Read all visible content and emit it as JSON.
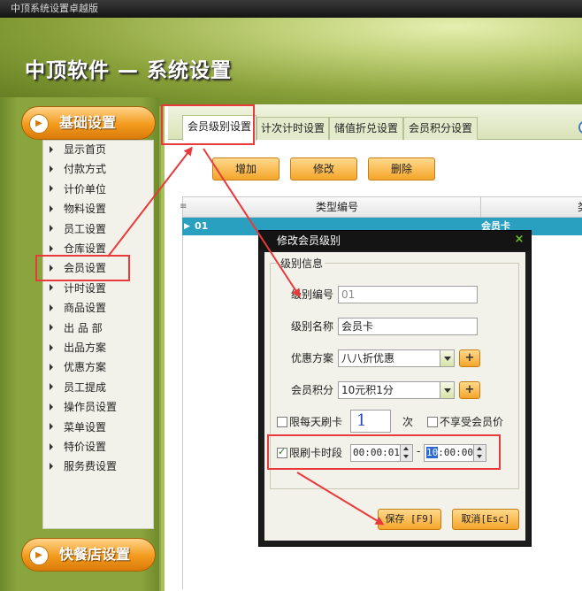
{
  "window": {
    "title": "中顶系统设置卓越版"
  },
  "header": {
    "title": "中顶软件 — 系统设置"
  },
  "sidebar": {
    "group_top": "基础设置",
    "group_bottom": "快餐店设置",
    "items": [
      "显示首页",
      "付款方式",
      "计价单位",
      "物料设置",
      "员工设置",
      "仓库设置",
      "会员设置",
      "计时设置",
      "商品设置",
      "出 品 部",
      "出品方案",
      "优惠方案",
      "员工提成",
      "操作员设置",
      "菜单设置",
      "特价设置",
      "服务费设置"
    ]
  },
  "tabs": [
    "会员级别设置",
    "计次计时设置",
    "储值折兑设置",
    "会员积分设置"
  ],
  "toolbar": {
    "add": "增加",
    "edit": "修改",
    "delete": "删除"
  },
  "grid": {
    "columns": [
      "类型编号",
      "类"
    ],
    "row": {
      "code": "01",
      "name": "会员卡"
    }
  },
  "dialog": {
    "title": "修改会员级别",
    "group": "级别信息",
    "code_label": "级别编号",
    "code_value": "01",
    "name_label": "级别名称",
    "name_value": "会员卡",
    "discount_label": "优惠方案",
    "discount_value": "八八折优惠",
    "points_label": "会员积分",
    "points_value": "10元积1分",
    "daily_label": "限每天刷卡",
    "daily_value": "1",
    "times_label": "次",
    "no_price_label": "不享受会员价",
    "limit_label": "限刷卡时段",
    "time_start": "00:00:01",
    "time_sep": "-",
    "time_end_sel": "10",
    "time_end_rest": ":00:00",
    "save": "保存 [F9]",
    "cancel": "取消[Esc]"
  },
  "plus_glyph": "+",
  "close_glyph": "×",
  "colors": {
    "highlight": "#e83a3a",
    "row_selected": "#2aa0c0",
    "accent": "#f5a52a"
  }
}
